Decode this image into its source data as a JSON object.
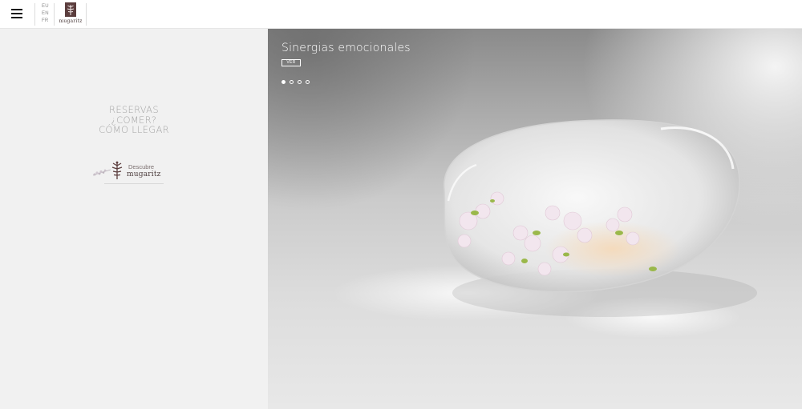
{
  "header": {
    "menu_icon": "hamburger-menu-icon",
    "languages": [
      "EU",
      "EN",
      "FR"
    ],
    "logo": {
      "wordmark": "mugaritz",
      "icon": "tree-logo-icon"
    }
  },
  "left_panel": {
    "links": [
      "RESERVAS",
      "¿COMER?",
      "CÓMO LLEGAR"
    ],
    "discover": {
      "top": "Descubre",
      "bottom": "mugaritz",
      "icon": "tree-branch-icon"
    }
  },
  "slider": {
    "title": "Sinergias emocionales",
    "button_label": "VER",
    "dots_count": 4,
    "active_dot": 0
  },
  "colors": {
    "header_bg": "#ffffff",
    "panel_bg": "#f1f1f1",
    "link_text": "#a4a4a4",
    "brand": "#4a3a3a"
  }
}
